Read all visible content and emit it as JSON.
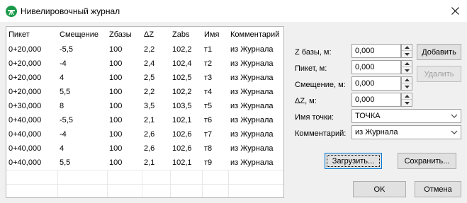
{
  "window": {
    "title": "Нивелировочный журнал",
    "icon": "level-instrument-icon",
    "close": "close-icon"
  },
  "grid": {
    "columns": [
      "Пикет",
      "Смещение",
      "Zбазы",
      "ΔZ",
      "Zabs",
      "Имя",
      "Комментарий"
    ],
    "rows": [
      [
        "0+20,000",
        "-5,5",
        "100",
        "2,2",
        "102,2",
        "т1",
        "из Журнала"
      ],
      [
        "0+20,000",
        "-4",
        "100",
        "2,4",
        "102,4",
        "т2",
        "из Журнала"
      ],
      [
        "0+20,000",
        "4",
        "100",
        "2,5",
        "102,5",
        "т3",
        "из Журнала"
      ],
      [
        "0+20,000",
        "5,5",
        "100",
        "2,2",
        "102,2",
        "т4",
        "из Журнала"
      ],
      [
        "0+30,000",
        "8",
        "100",
        "3,5",
        "103,5",
        "т5",
        "из Журнала"
      ],
      [
        "0+40,000",
        "-5,5",
        "100",
        "2,1",
        "102,1",
        "т6",
        "из Журнала"
      ],
      [
        "0+40,000",
        "-4",
        "100",
        "2,6",
        "102,6",
        "т7",
        "из Журнала"
      ],
      [
        "0+40,000",
        "4",
        "100",
        "2,6",
        "102,6",
        "т8",
        "из Журнала"
      ],
      [
        "0+40,000",
        "5,5",
        "100",
        "2,1",
        "102,1",
        "т9",
        "из Журнала"
      ]
    ]
  },
  "form": {
    "z_base_label": "Z базы, м:",
    "z_base_value": "0,000",
    "picket_label": "Пикет, м:",
    "picket_value": "0,000",
    "offset_label": "Смещение, м:",
    "offset_value": "0,000",
    "dz_label": "ΔZ, м:",
    "dz_value": "0,000",
    "point_name_label": "Имя точки:",
    "point_name_value": "ТОЧКА",
    "comment_label": "Комментарий:",
    "comment_value": "из Журнала"
  },
  "buttons": {
    "add": "Добавить",
    "delete": "Удалить",
    "load": "Загрузить...",
    "save": "Сохранить...",
    "ok": "OK",
    "cancel": "Отмена"
  },
  "colors": {
    "icon_green": "#1a9a4a",
    "focus_blue": "#0078d7"
  }
}
